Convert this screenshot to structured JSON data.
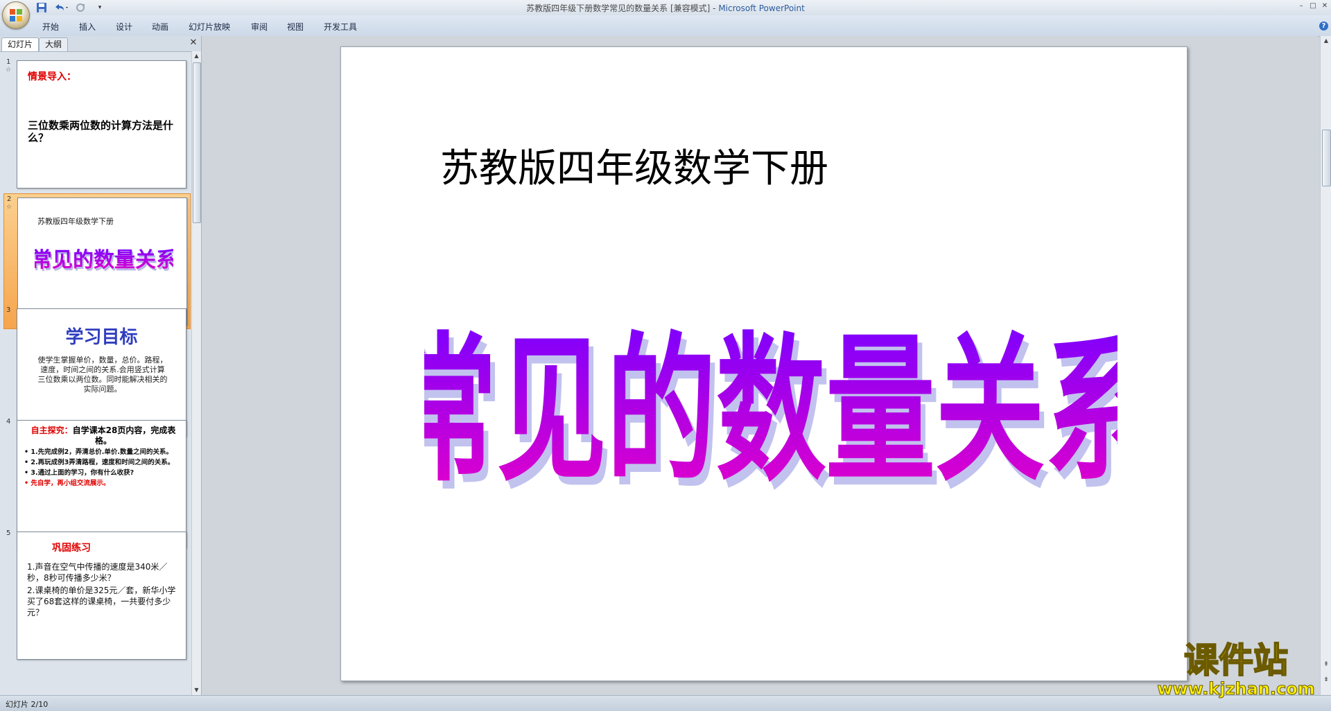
{
  "window": {
    "title": "苏教版四年级下册数学常见的数量关系 [兼容模式] - ",
    "app_name": "Microsoft PowerPoint",
    "controls": {
      "minimize": "–",
      "maximize": "□",
      "close": "✕"
    }
  },
  "qat": {
    "more": "▾"
  },
  "ribbon": {
    "tabs": [
      "开始",
      "插入",
      "设计",
      "动画",
      "幻灯片放映",
      "审阅",
      "视图",
      "开发工具"
    ],
    "help": "?"
  },
  "pane": {
    "tabs": {
      "slides": "幻灯片",
      "outline": "大纲"
    },
    "close": "✕",
    "star": "☆",
    "thumbs": [
      {
        "num": "1",
        "heading": "情景导入：",
        "body": "三位数乘两位数的计算方法是什么？"
      },
      {
        "num": "2",
        "subtitle": "苏教版四年级数学下册",
        "wordart": "常见的数量关系"
      },
      {
        "num": "3",
        "heading": "学习目标",
        "body": "使学生掌握单价，数量，总价。路程，速度，时间之间的关系.会用竖式计算三位数乘以两位数。同时能解决相关的实际问题。"
      },
      {
        "num": "4",
        "heading_red": "自主探究：",
        "heading_black": "自学课本28页内容，完成表格。",
        "bullets": [
          "1.先完成例2，弄清总价.单价.数量之间的关系。",
          "2.再玩成例3弄清路程，速度和时间之间的关系。",
          "3.通过上面的学习，你有什么收获?"
        ],
        "bullet_red": "先自学，再小组交流展示。"
      },
      {
        "num": "5",
        "heading": "巩固练习",
        "items": [
          "1.声音在空气中传播的速度是340米／秒，8秒可传播多少米？",
          "2.课桌椅的单价是325元／套，新华小学买了68套这样的课桌椅，一共要付多少元？"
        ]
      }
    ]
  },
  "slide": {
    "subtitle": "苏教版四年级数学下册",
    "wordart": "常见的数量关系"
  },
  "scrollbar": {
    "up": "▲",
    "down": "▼",
    "prev": "⇞",
    "next": "⇟"
  },
  "status": {
    "text": "幻灯片 2/10"
  },
  "watermark": {
    "title": "课件站",
    "url": "www.kjzhan.com"
  },
  "colors": {
    "wordart_top": "#7a00ff",
    "wordart_bottom": "#e600c8",
    "accent_red": "#e00000",
    "selection": "#f6a54d",
    "blue_heading": "#2f3dbf"
  }
}
